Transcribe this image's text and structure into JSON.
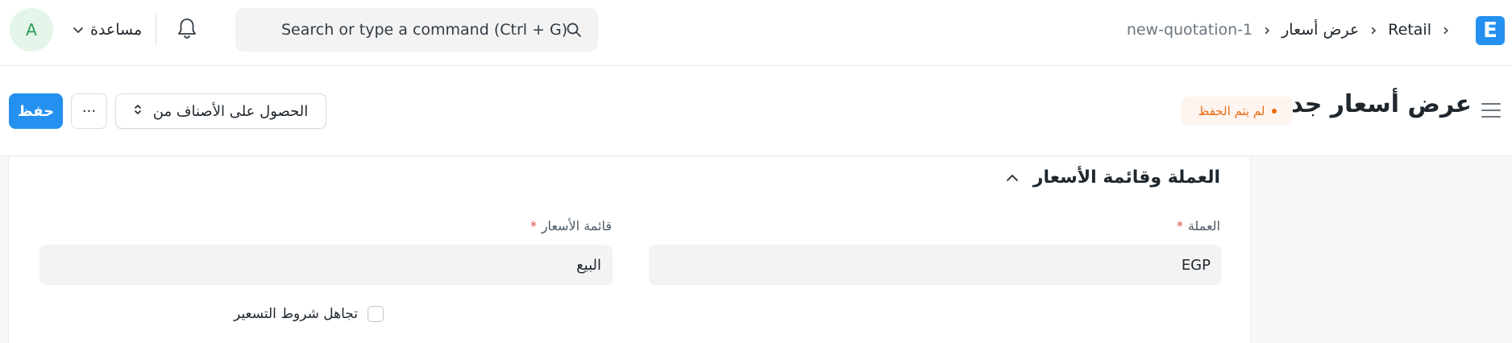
{
  "navbar": {
    "logo_letter": "E",
    "breadcrumbs": [
      "Retail",
      "عرض أسعار",
      "new-quotation-1"
    ],
    "breadcrumb_separator": "›",
    "search": {
      "placeholder": "Search or type a command (Ctrl + G)"
    },
    "help_label": "مساعدة",
    "avatar_initial": "A",
    "icons": [
      "search-icon",
      "bell-icon",
      "chevron-down-icon"
    ]
  },
  "page": {
    "title": "عرض أسعار جديد",
    "status_badge": "لم يتم الحفظ",
    "get_items_label": "الحصول على الأصناف من",
    "more_label": "···",
    "save_label": "حفظ"
  },
  "section": {
    "title": "العملة وقائمة الأسعار",
    "fields": {
      "currency": {
        "label": "العملة",
        "value": "EGP",
        "required": true
      },
      "price_list": {
        "label": "قائمة الأسعار",
        "value": "البيع",
        "required": true
      }
    },
    "ignore_pricing_rule_label": "تجاهل شروط التسعير"
  },
  "colors": {
    "accent": "#2490ef",
    "badge_text": "#e86c13",
    "badge_bg": "#fff5f0",
    "required": "#e24c4c",
    "avatar_bg": "#e4f5e9",
    "avatar_text": "#2f9d58"
  }
}
